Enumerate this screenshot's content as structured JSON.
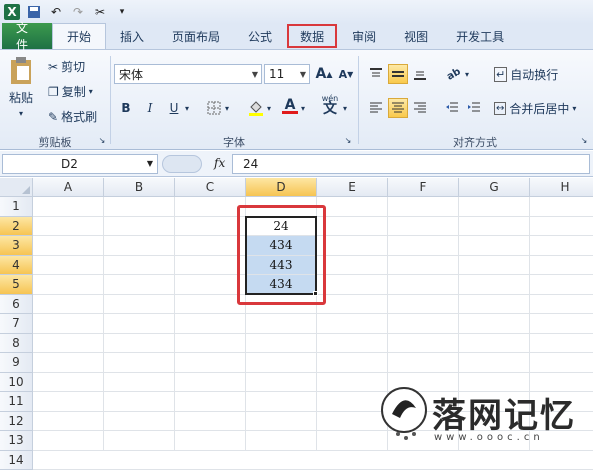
{
  "qat": {
    "items": [
      "excel-logo",
      "save-icon",
      "undo-icon",
      "redo-icon",
      "tools-icon"
    ]
  },
  "tabs": [
    "文件",
    "开始",
    "插入",
    "页面布局",
    "公式",
    "数据",
    "审阅",
    "视图",
    "开发工具"
  ],
  "ribbon": {
    "clipboard": {
      "paste": "粘贴",
      "cut": "剪切",
      "copy": "复制",
      "format_painter": "格式刷",
      "label": "剪贴板"
    },
    "font": {
      "name": "宋体",
      "size": "11",
      "bold": "B",
      "italic": "I",
      "underline": "U",
      "label": "字体",
      "grow": "A",
      "shrink": "A",
      "wen": "wén"
    },
    "alignment": {
      "wrap_text": "自动换行",
      "merge_center": "合并后居中",
      "label": "对齐方式"
    }
  },
  "formula_bar": {
    "name_box": "D2",
    "fx": "fx",
    "value": "24"
  },
  "sheet": {
    "columns": [
      "A",
      "B",
      "C",
      "D",
      "E",
      "F",
      "G",
      "H"
    ],
    "rows": [
      "1",
      "2",
      "3",
      "4",
      "5",
      "6",
      "7",
      "8",
      "9",
      "10",
      "11",
      "12",
      "13",
      "14"
    ],
    "selected_column": "D",
    "cells": [
      {
        "ref": "D2",
        "value": "24"
      },
      {
        "ref": "D3",
        "value": "434"
      },
      {
        "ref": "D4",
        "value": "443"
      },
      {
        "ref": "D5",
        "value": "434"
      }
    ]
  },
  "watermark": {
    "text": "落网记忆",
    "url": "www.oooc.cn"
  },
  "colors": {
    "file_tab": "#1e7145",
    "annotation_red": "#d9383c",
    "selection_fill": "#c5daf1",
    "header_selected": "#f6c453"
  }
}
